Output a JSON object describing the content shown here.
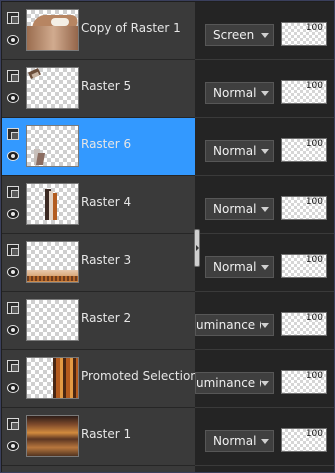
{
  "layers": [
    {
      "name": "Copy of Raster 1",
      "blend": "Screen",
      "opacity": "100",
      "selected": false,
      "thumb": "wave-brown"
    },
    {
      "name": "Raster 5",
      "blend": "Normal",
      "opacity": "100",
      "selected": false,
      "thumb": "feather-top-left"
    },
    {
      "name": "Raster 6",
      "blend": "Normal",
      "opacity": "100",
      "selected": true,
      "thumb": "figure-small"
    },
    {
      "name": "Raster 4",
      "blend": "Normal",
      "opacity": "100",
      "selected": false,
      "thumb": "feather-center"
    },
    {
      "name": "Raster 3",
      "blend": "Normal",
      "opacity": "100",
      "selected": false,
      "thumb": "orange-horizon"
    },
    {
      "name": "Raster 2",
      "blend": "uminance (",
      "opacity": "100",
      "selected": false,
      "thumb": "empty"
    },
    {
      "name": "Promoted Selection",
      "blend": "uminance (",
      "opacity": "100",
      "selected": false,
      "thumb": "orange-texture"
    },
    {
      "name": "Raster 1",
      "blend": "Normal",
      "opacity": "100",
      "selected": false,
      "thumb": "blur-orange"
    }
  ],
  "colors": {
    "selected": "#3399ff",
    "panel": "#3a3a3a",
    "props": "#242424"
  }
}
